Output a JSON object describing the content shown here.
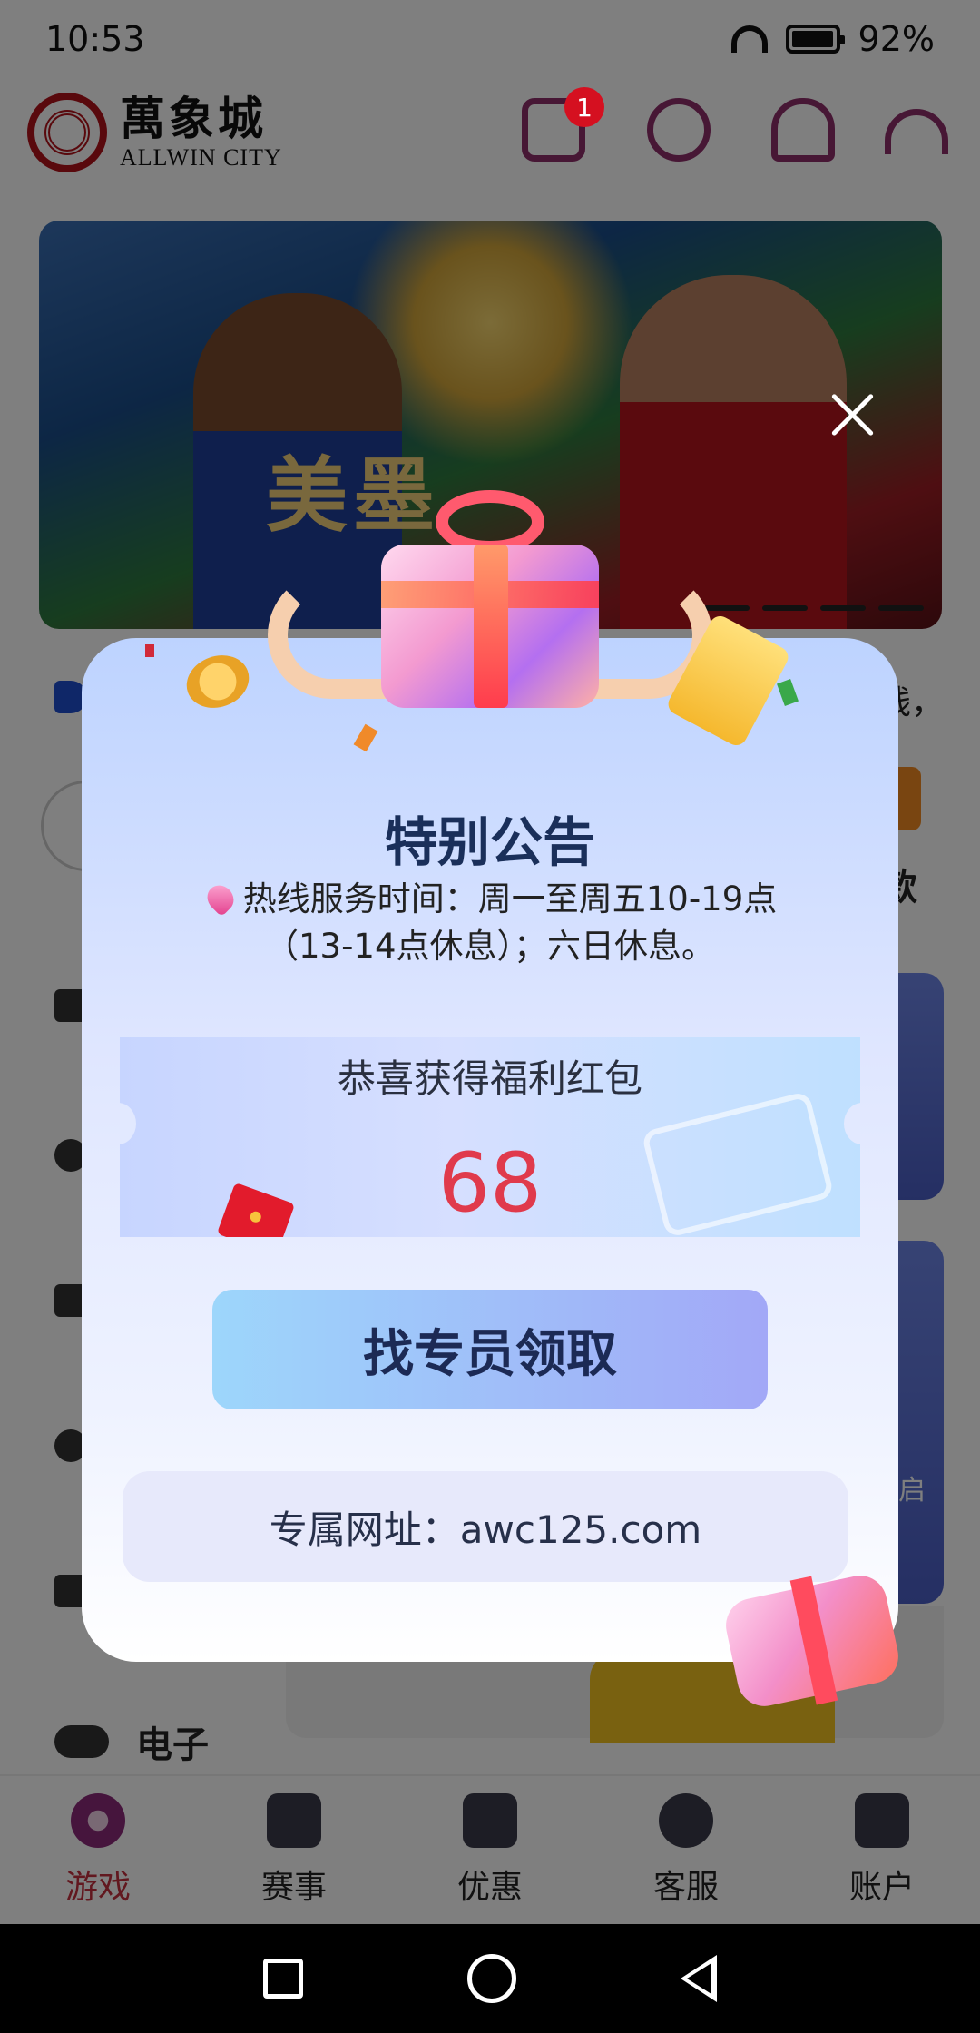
{
  "status_bar": {
    "time": "10:53",
    "battery": "92%"
  },
  "header": {
    "logo_cn": "萬象城",
    "logo_en": "ALLWIN CITY",
    "mail_badge": "1"
  },
  "banner": {
    "title_text": "美墨"
  },
  "marquee": {
    "tail_text": "线，"
  },
  "account": {
    "deposit_tail": "款"
  },
  "categories": {
    "electronic": "电子"
  },
  "modal": {
    "title": "特别公告",
    "notice_line1": "热线服务时间：周一至周五10-19点",
    "notice_line2": "（13-14点休息）；六日休息。",
    "coupon_label": "恭喜获得福利红包",
    "coupon_amount": "68",
    "claim_button": "找专员领取",
    "exclusive_url": "专属网址：awc125.com"
  },
  "promo": {
    "open_tail": "启"
  },
  "tabs": [
    {
      "label": "游戏",
      "icon": "game-icon",
      "active": true
    },
    {
      "label": "赛事",
      "icon": "stadium-icon",
      "active": false
    },
    {
      "label": "优惠",
      "icon": "gift-icon",
      "active": false
    },
    {
      "label": "客服",
      "icon": "chat-icon",
      "active": false
    },
    {
      "label": "账户",
      "icon": "wallet-icon",
      "active": false
    }
  ],
  "colors": {
    "accent_red": "#c4303e",
    "brand_purple": "#8f2f6a",
    "coupon_red": "#e03a4c"
  }
}
